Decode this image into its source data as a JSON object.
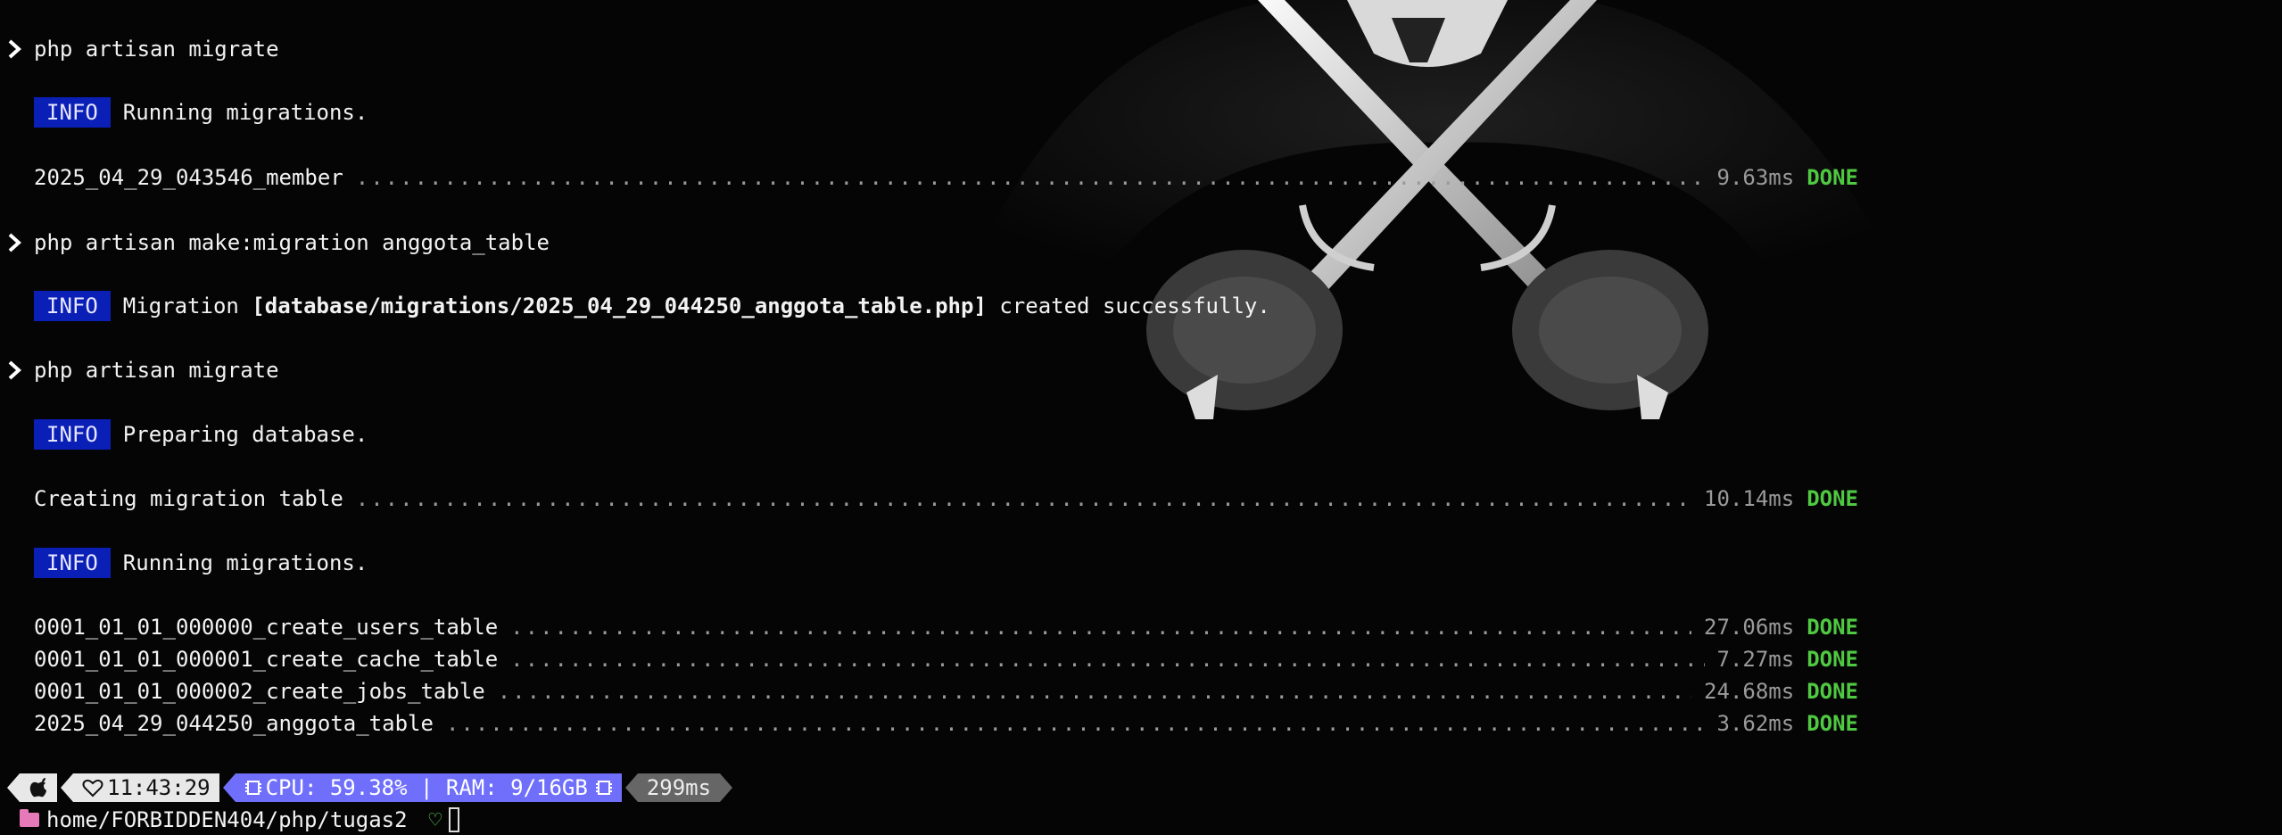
{
  "lines": {
    "cmd1": "php artisan migrate",
    "info1_badge": "INFO",
    "info1_text": "Running migrations.",
    "cmd2": "php artisan make:migration anggota_table",
    "info2_badge": "INFO",
    "info2_prefix": "Migration ",
    "info2_path": "[database/migrations/2025_04_29_044250_anggota_table.php]",
    "info2_suffix": " created successfully.",
    "cmd3": "php artisan migrate",
    "info3_badge": "INFO",
    "info3_text": "Preparing database.",
    "info4_badge": "INFO",
    "info4_text": "Running migrations."
  },
  "migrations": [
    {
      "name": "2025_04_29_043546_member",
      "time": "9.63ms",
      "status": "DONE"
    },
    {
      "name": "Creating migration table",
      "time": "10.14ms",
      "status": "DONE"
    },
    {
      "name": "0001_01_01_000000_create_users_table",
      "time": "27.06ms",
      "status": "DONE"
    },
    {
      "name": "0001_01_01_000001_create_cache_table",
      "time": "7.27ms",
      "status": "DONE"
    },
    {
      "name": "0001_01_01_000002_create_jobs_table",
      "time": "24.68ms",
      "status": "DONE"
    },
    {
      "name": "2025_04_29_044250_anggota_table",
      "time": "3.62ms",
      "status": "DONE"
    }
  ],
  "statusbar": {
    "clock": "11:43:29",
    "sysinfo": "CPU: 59.38% | RAM: 9/16GB",
    "duration": "299ms"
  },
  "path": "home/FORBIDDEN404/php/tugas2",
  "colors": {
    "info_badge": "#0a1fb5",
    "done": "#4fc941",
    "sysinfo_bg": "#6f6ffb",
    "folder": "#e67ab8"
  }
}
